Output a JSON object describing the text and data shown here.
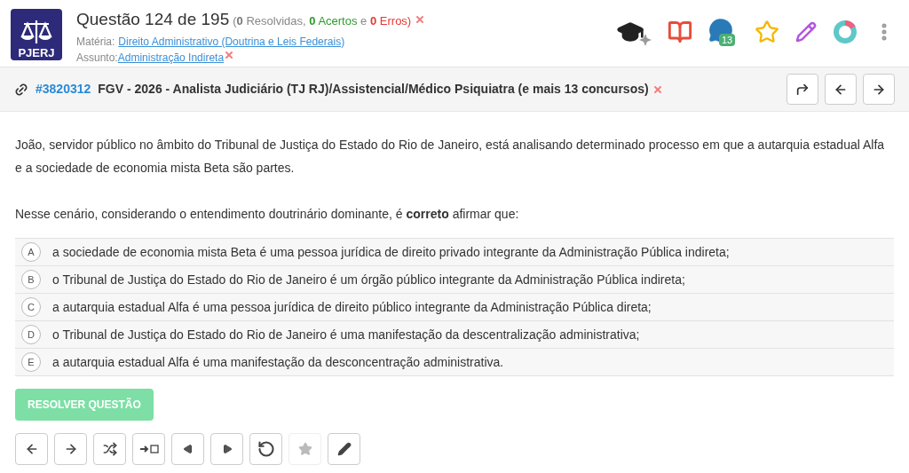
{
  "header": {
    "logo_text": "PJERJ",
    "title": "Questão 124 de 195",
    "stats": {
      "open": "(",
      "resolved_count": "0",
      "resolved_label": "Resolvidas,",
      "correct_count": "0",
      "correct_label": "Acertos",
      "and": "e",
      "wrong_count": "0",
      "wrong_label": "Erros)"
    },
    "materia_label": "Matéria:",
    "materia": "Direito Administrativo (Doutrina e Leis Federais)",
    "assunto_label": "Assunto:",
    "assunto": "Administração Indireta",
    "comments_count": "13"
  },
  "question_bar": {
    "id": "#3820312",
    "exam": "FGV - 2026 - Analista Judiciário (TJ RJ)/Assistencial/Médico Psiquiatra (e mais 13 concursos)"
  },
  "statement": [
    "João, servidor público no âmbito do Tribunal de Justiça do Estado do Rio de Janeiro, está analisando determinado processo em que a autarquia estadual Alfa e a sociedade de economia mista Beta são partes.",
    "Nesse cenário, considerando o entendimento doutrinário dominante, é **correto** afirmar que:"
  ],
  "options": [
    {
      "letter": "A",
      "text": "a sociedade de economia mista Beta é uma pessoa jurídica de direito privado integrante da Administração Pública indireta;",
      "selected": false
    },
    {
      "letter": "B",
      "text": "o Tribunal de Justiça do Estado do Rio de Janeiro é um órgão público integrante da Administração Pública indireta;",
      "selected": false
    },
    {
      "letter": "C",
      "text": "a autarquia estadual Alfa é uma pessoa jurídica de direito público integrante da Administração Pública direta;",
      "selected": false
    },
    {
      "letter": "D",
      "text": "o Tribunal de Justiça do Estado do Rio de Janeiro é uma manifestação da descentralização administrativa;",
      "selected": false
    },
    {
      "letter": "E",
      "text": "a autarquia estadual Alfa é uma manifestação da desconcentração administrativa.",
      "selected": false
    }
  ],
  "submit": {
    "label": "RESOLVER QUESTÃO",
    "disabled": true
  },
  "toolbar": [
    {
      "kind": "prev",
      "disabled": false
    },
    {
      "kind": "next",
      "disabled": false
    },
    {
      "kind": "shuffle",
      "disabled": false
    },
    {
      "kind": "jump",
      "disabled": false
    },
    {
      "kind": "back",
      "disabled": false
    },
    {
      "kind": "forward",
      "disabled": false
    },
    {
      "kind": "reset",
      "disabled": false
    },
    {
      "kind": "star",
      "disabled": true
    },
    {
      "kind": "edit",
      "disabled": false
    }
  ]
}
